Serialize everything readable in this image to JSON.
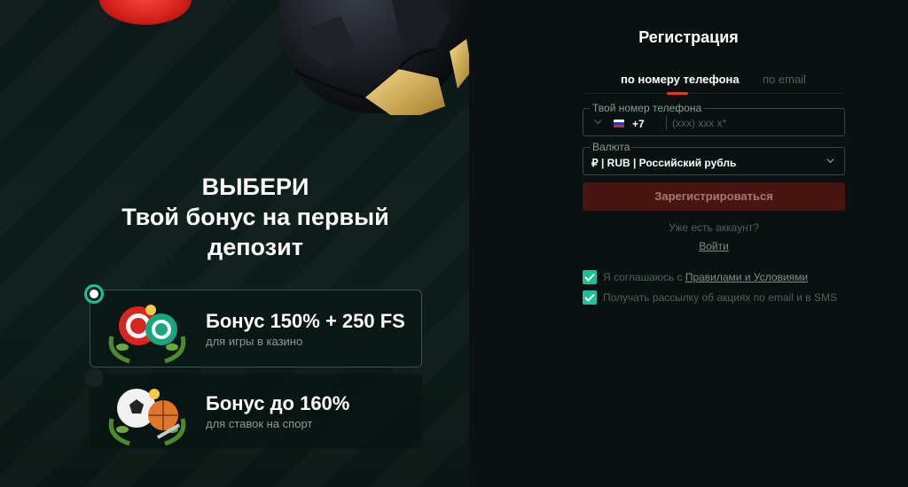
{
  "colors": {
    "accent": "#1fbf98",
    "brand_red": "#e23a1f",
    "background": "#0b1413"
  },
  "promo": {
    "headline_1": "ВЫБЕРИ",
    "headline_2": "Твой бонус на первый депозит",
    "bonuses": [
      {
        "title": "Бонус 150% + 250 FS",
        "subtitle": "для игры в казино",
        "selected": true,
        "icon": "casino-chips-icon"
      },
      {
        "title": "Бонус до 160%",
        "subtitle": "для ставок на спорт",
        "selected": false,
        "icon": "sports-balls-icon"
      }
    ]
  },
  "form": {
    "title": "Регистрация",
    "tabs": [
      {
        "label": "по номеру телефона",
        "active": true
      },
      {
        "label": "по email",
        "active": false
      }
    ],
    "phone": {
      "legend": "Твой номер телефона",
      "country_code": "+7",
      "placeholder": "(xxx) xxx x*",
      "flag": "russia-flag-icon"
    },
    "currency": {
      "legend": "Валюта",
      "value": "₽ | RUB | Российский рубль"
    },
    "submit_label": "Зарегистрироваться",
    "have_account": "Уже есть аккаунт?",
    "login_link": "Войти",
    "consent": {
      "rules_prefix": "Я соглашаюсь с ",
      "rules_link": "Правилами и Условиями",
      "rules_checked": true,
      "newsletter": "Получать рассылку об акциях по email и в SMS",
      "newsletter_checked": true
    }
  }
}
